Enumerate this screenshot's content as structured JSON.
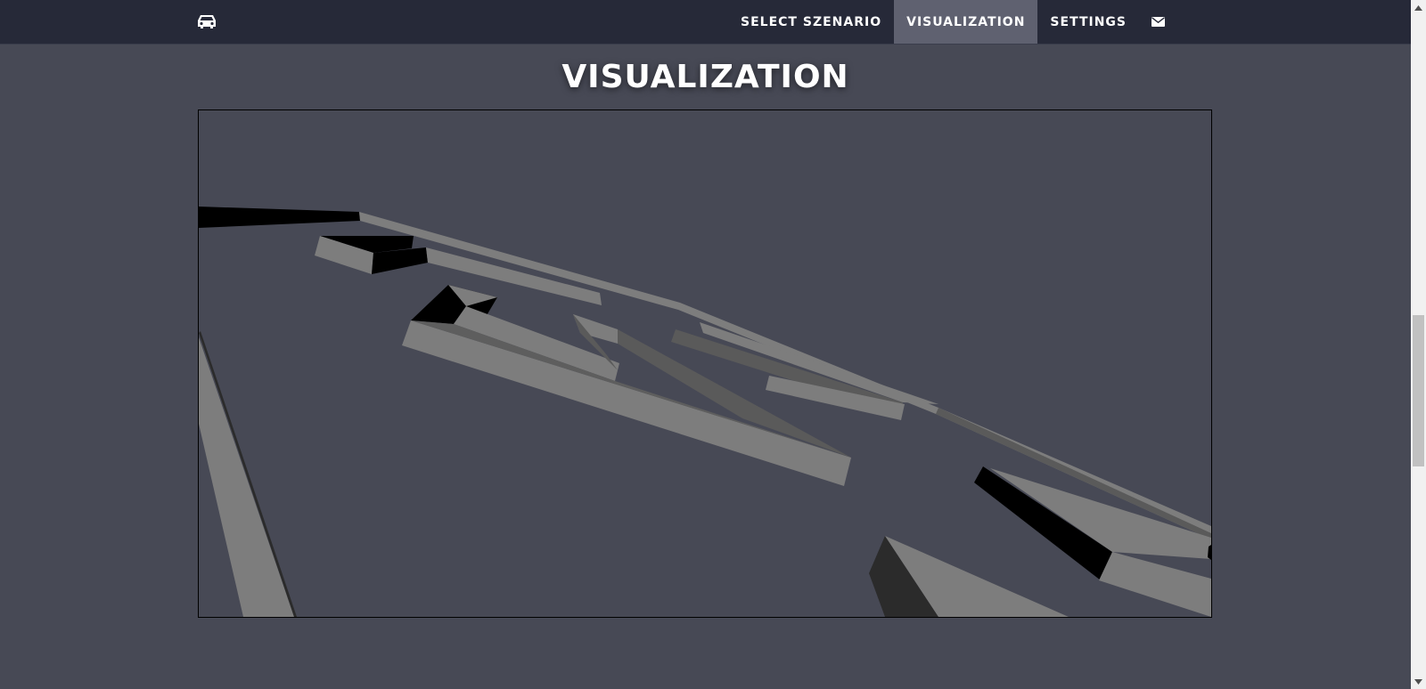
{
  "navbar": {
    "brand_icon": "car-icon",
    "items": [
      {
        "label": "SELECT SZENARIO",
        "active": false
      },
      {
        "label": "VISUALIZATION",
        "active": true
      },
      {
        "label": "SETTINGS",
        "active": false
      }
    ],
    "mail_icon": "envelope-icon"
  },
  "page": {
    "title": "VISUALIZATION"
  },
  "visualization": {
    "description_icon": "3d-scene",
    "colors": {
      "background": "#474955",
      "wall_light": "#7d7d7d",
      "wall_mid": "#5a5a5a",
      "wall_dark": "#2b2b2b",
      "wall_black": "#000000"
    }
  },
  "theme": {
    "navbar_bg": "#262938",
    "active_tab_bg": "#5f6170",
    "page_bg": "#474955",
    "text": "#ffffff"
  }
}
